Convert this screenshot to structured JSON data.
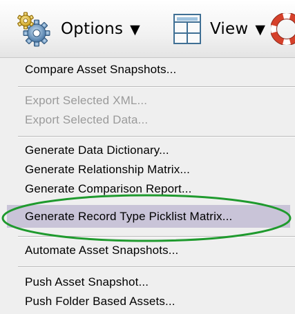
{
  "toolbar": {
    "options_label": "Options",
    "view_label": "View",
    "caret": "▼",
    "icons": [
      "gears-icon",
      "window-layout-icon",
      "help-lifebuoy-icon"
    ]
  },
  "menu": {
    "items": [
      {
        "label": "Compare Asset Snapshots...",
        "enabled": true
      },
      {
        "label": "Export Selected XML...",
        "enabled": false
      },
      {
        "label": "Export Selected Data...",
        "enabled": false
      },
      {
        "label": "Generate Data Dictionary...",
        "enabled": true
      },
      {
        "label": "Generate Relationship Matrix...",
        "enabled": true
      },
      {
        "label": "Generate Comparison Report...",
        "enabled": true
      },
      {
        "label": "Generate Record Type Picklist Matrix...",
        "enabled": true,
        "highlighted": true
      },
      {
        "label": "Automate Asset Snapshots...",
        "enabled": true
      },
      {
        "label": "Push Asset Snapshot...",
        "enabled": true
      },
      {
        "label": "Push Folder Based Assets...",
        "enabled": true
      }
    ]
  },
  "colors": {
    "menu_bg": "#efefef",
    "highlight_bg": "#c9c4d8",
    "annotation_ellipse": "#1f9a2e",
    "disabled_text": "#9a9a9a"
  }
}
